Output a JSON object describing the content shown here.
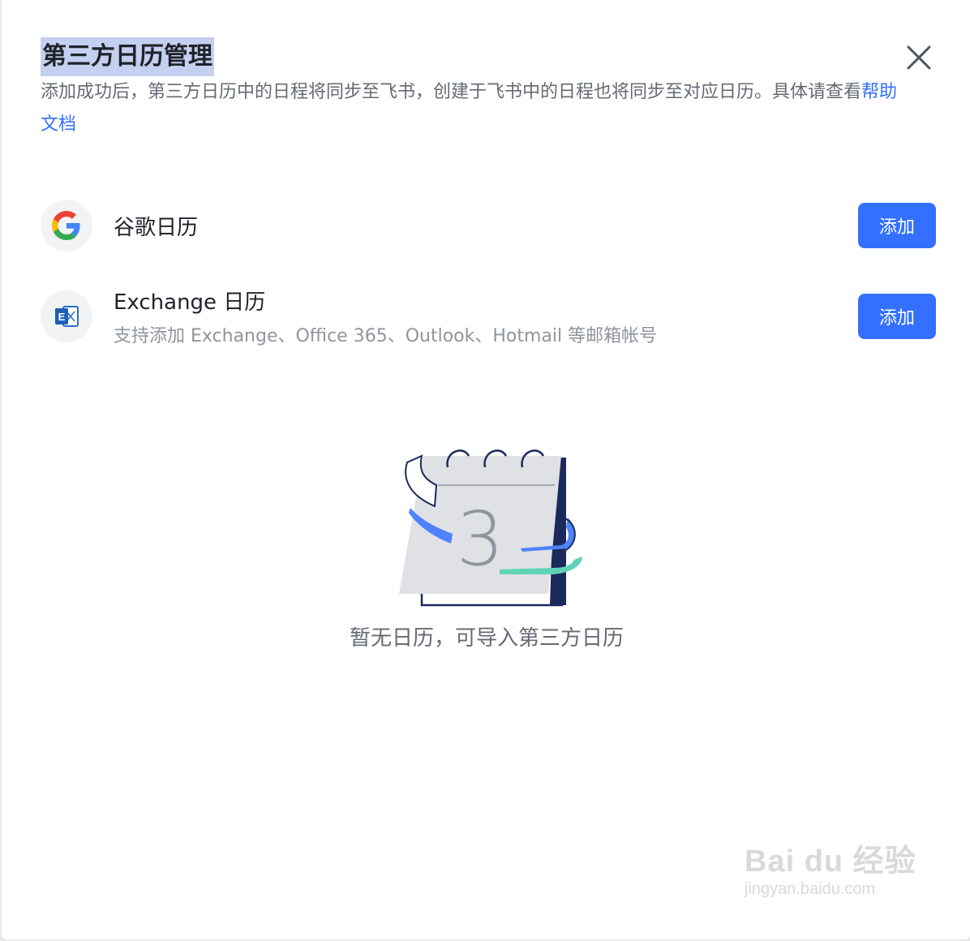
{
  "dialog": {
    "title": "第三方日历管理",
    "description": "添加成功后，第三方日历中的日程将同步至飞书，创建于飞书中的日程也将同步至对应日历。具体请查看",
    "help_link": "帮助文档",
    "close_icon": "close-icon"
  },
  "providers": [
    {
      "name": "谷歌日历",
      "subtitle": "",
      "icon": "google-icon",
      "button_label": "添加"
    },
    {
      "name": "Exchange 日历",
      "subtitle": "支持添加 Exchange、Office 365、Outlook、Hotmail 等邮箱帐号",
      "icon": "exchange-icon",
      "button_label": "添加"
    }
  ],
  "empty_state": {
    "illustration": "calendar-illustration",
    "calendar_number": "3",
    "text": "暂无日历，可导入第三方日历"
  },
  "watermark": {
    "main": "Bai du 经验",
    "sub": "jingyan.baidu.com"
  },
  "colors": {
    "primary": "#3370ff",
    "title_highlight": "#c5cff0",
    "text_primary": "#1f2329",
    "text_secondary": "#646a73",
    "accent_green": "#5fd3b5",
    "dark_navy": "#1b2a5a"
  }
}
